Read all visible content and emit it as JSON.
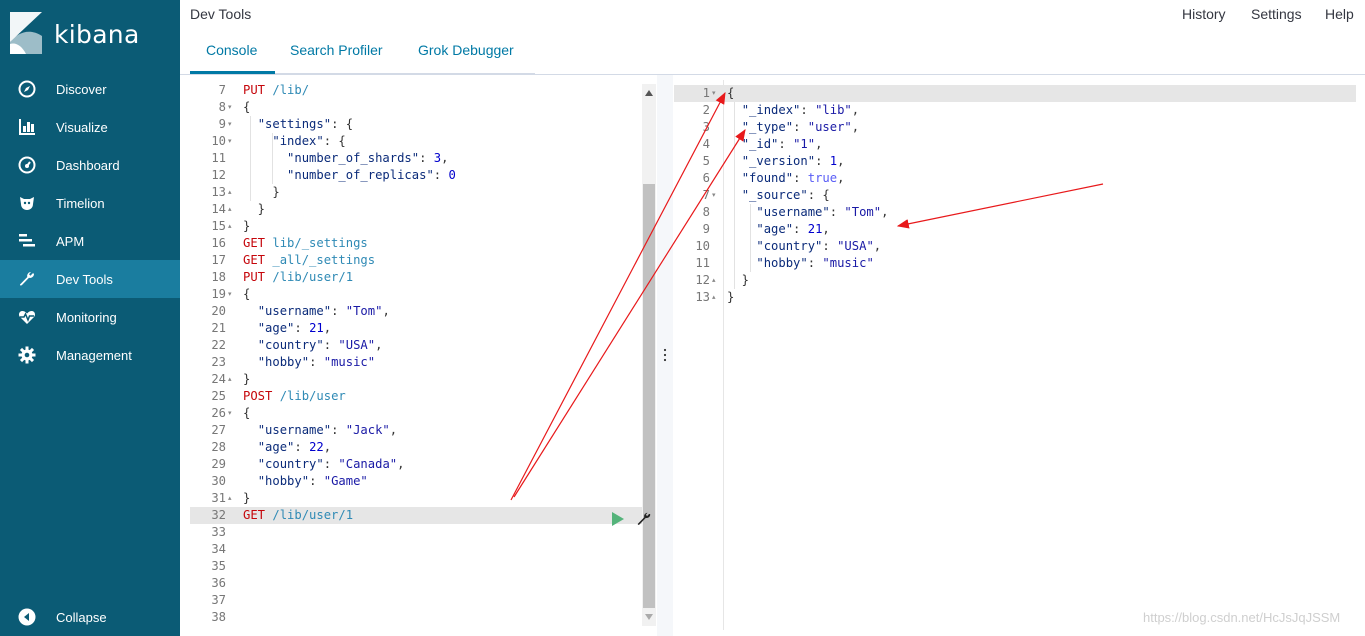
{
  "app": {
    "brand": "kibana",
    "page_title": "Dev Tools"
  },
  "topnav": {
    "history": "History",
    "settings": "Settings",
    "help": "Help"
  },
  "tabs": [
    {
      "label": "Console",
      "active": true
    },
    {
      "label": "Search Profiler",
      "active": false
    },
    {
      "label": "Grok Debugger",
      "active": false
    }
  ],
  "sidebar": {
    "items": [
      {
        "label": "Discover",
        "icon": "compass-icon"
      },
      {
        "label": "Visualize",
        "icon": "bar-chart-icon"
      },
      {
        "label": "Dashboard",
        "icon": "dashboard-icon"
      },
      {
        "label": "Timelion",
        "icon": "timelion-icon"
      },
      {
        "label": "APM",
        "icon": "apm-icon"
      },
      {
        "label": "Dev Tools",
        "icon": "wrench-icon",
        "active": true
      },
      {
        "label": "Monitoring",
        "icon": "heartbeat-icon"
      },
      {
        "label": "Management",
        "icon": "gear-icon"
      }
    ],
    "collapse": "Collapse"
  },
  "editor": {
    "lines": [
      {
        "n": "7",
        "fold": "",
        "tokens": [
          [
            "m",
            "PUT"
          ],
          [
            "p",
            " "
          ],
          [
            "u",
            "/lib/"
          ]
        ]
      },
      {
        "n": "8",
        "fold": "▾",
        "tokens": [
          [
            "p",
            "{"
          ]
        ]
      },
      {
        "n": "9",
        "fold": "▾",
        "tokens": [
          [
            "p",
            "  "
          ],
          [
            "k",
            "\"settings\""
          ],
          [
            "p",
            ": {"
          ]
        ]
      },
      {
        "n": "10",
        "fold": "▾",
        "tokens": [
          [
            "p",
            "    "
          ],
          [
            "k",
            "\"index\""
          ],
          [
            "p",
            ": {"
          ]
        ]
      },
      {
        "n": "11",
        "fold": "",
        "tokens": [
          [
            "p",
            "      "
          ],
          [
            "k",
            "\"number_of_shards\""
          ],
          [
            "p",
            ": "
          ],
          [
            "n",
            "3"
          ],
          [
            "p",
            ","
          ]
        ]
      },
      {
        "n": "12",
        "fold": "",
        "tokens": [
          [
            "p",
            "      "
          ],
          [
            "k",
            "\"number_of_replicas\""
          ],
          [
            "p",
            ": "
          ],
          [
            "n",
            "0"
          ]
        ]
      },
      {
        "n": "13",
        "fold": "▴",
        "tokens": [
          [
            "p",
            "    }"
          ]
        ]
      },
      {
        "n": "14",
        "fold": "▴",
        "tokens": [
          [
            "p",
            "  }"
          ]
        ]
      },
      {
        "n": "15",
        "fold": "▴",
        "tokens": [
          [
            "p",
            "}"
          ]
        ]
      },
      {
        "n": "16",
        "fold": "",
        "tokens": [
          [
            "m",
            "GET"
          ],
          [
            "p",
            " "
          ],
          [
            "u",
            "lib/_settings"
          ]
        ]
      },
      {
        "n": "17",
        "fold": "",
        "tokens": [
          [
            "m",
            "GET"
          ],
          [
            "p",
            " "
          ],
          [
            "u",
            "_all/_settings"
          ]
        ]
      },
      {
        "n": "18",
        "fold": "",
        "tokens": [
          [
            "m",
            "PUT"
          ],
          [
            "p",
            " "
          ],
          [
            "u",
            "/lib/user/1"
          ]
        ]
      },
      {
        "n": "19",
        "fold": "▾",
        "tokens": [
          [
            "p",
            "{"
          ]
        ]
      },
      {
        "n": "20",
        "fold": "",
        "tokens": [
          [
            "p",
            "  "
          ],
          [
            "k",
            "\"username\""
          ],
          [
            "p",
            ": "
          ],
          [
            "s",
            "\"Tom\""
          ],
          [
            "p",
            ","
          ]
        ]
      },
      {
        "n": "21",
        "fold": "",
        "tokens": [
          [
            "p",
            "  "
          ],
          [
            "k",
            "\"age\""
          ],
          [
            "p",
            ": "
          ],
          [
            "n",
            "21"
          ],
          [
            "p",
            ","
          ]
        ]
      },
      {
        "n": "22",
        "fold": "",
        "tokens": [
          [
            "p",
            "  "
          ],
          [
            "k",
            "\"country\""
          ],
          [
            "p",
            ": "
          ],
          [
            "s",
            "\"USA\""
          ],
          [
            "p",
            ","
          ]
        ]
      },
      {
        "n": "23",
        "fold": "",
        "tokens": [
          [
            "p",
            "  "
          ],
          [
            "k",
            "\"hobby\""
          ],
          [
            "p",
            ": "
          ],
          [
            "s",
            "\"music\""
          ]
        ]
      },
      {
        "n": "24",
        "fold": "▴",
        "tokens": [
          [
            "p",
            "}"
          ]
        ]
      },
      {
        "n": "25",
        "fold": "",
        "tokens": [
          [
            "m",
            "POST"
          ],
          [
            "p",
            " "
          ],
          [
            "u",
            "/lib/user"
          ]
        ]
      },
      {
        "n": "26",
        "fold": "▾",
        "tokens": [
          [
            "p",
            "{"
          ]
        ]
      },
      {
        "n": "27",
        "fold": "",
        "tokens": [
          [
            "p",
            "  "
          ],
          [
            "k",
            "\"username\""
          ],
          [
            "p",
            ": "
          ],
          [
            "s",
            "\"Jack\""
          ],
          [
            "p",
            ","
          ]
        ]
      },
      {
        "n": "28",
        "fold": "",
        "tokens": [
          [
            "p",
            "  "
          ],
          [
            "k",
            "\"age\""
          ],
          [
            "p",
            ": "
          ],
          [
            "n",
            "22"
          ],
          [
            "p",
            ","
          ]
        ]
      },
      {
        "n": "29",
        "fold": "",
        "tokens": [
          [
            "p",
            "  "
          ],
          [
            "k",
            "\"country\""
          ],
          [
            "p",
            ": "
          ],
          [
            "s",
            "\"Canada\""
          ],
          [
            "p",
            ","
          ]
        ]
      },
      {
        "n": "30",
        "fold": "",
        "tokens": [
          [
            "p",
            "  "
          ],
          [
            "k",
            "\"hobby\""
          ],
          [
            "p",
            ": "
          ],
          [
            "s",
            "\"Game\""
          ]
        ]
      },
      {
        "n": "31",
        "fold": "▴",
        "tokens": [
          [
            "p",
            "}"
          ]
        ]
      },
      {
        "n": "32",
        "fold": "",
        "tokens": [
          [
            "m",
            "GET"
          ],
          [
            "p",
            " "
          ],
          [
            "u",
            "/lib/user/1"
          ]
        ],
        "active": true
      },
      {
        "n": "33",
        "fold": "",
        "tokens": []
      },
      {
        "n": "34",
        "fold": "",
        "tokens": []
      },
      {
        "n": "35",
        "fold": "",
        "tokens": []
      },
      {
        "n": "36",
        "fold": "",
        "tokens": []
      },
      {
        "n": "37",
        "fold": "",
        "tokens": []
      },
      {
        "n": "38",
        "fold": "",
        "tokens": []
      }
    ]
  },
  "output": {
    "lines": [
      {
        "n": "1",
        "fold": "▾",
        "tokens": [
          [
            "p",
            "{"
          ]
        ],
        "active": true
      },
      {
        "n": "2",
        "fold": "",
        "tokens": [
          [
            "p",
            "  "
          ],
          [
            "k",
            "\"_index\""
          ],
          [
            "p",
            ": "
          ],
          [
            "s",
            "\"lib\""
          ],
          [
            "p",
            ","
          ]
        ]
      },
      {
        "n": "3",
        "fold": "",
        "tokens": [
          [
            "p",
            "  "
          ],
          [
            "k",
            "\"_type\""
          ],
          [
            "p",
            ": "
          ],
          [
            "s",
            "\"user\""
          ],
          [
            "p",
            ","
          ]
        ]
      },
      {
        "n": "4",
        "fold": "",
        "tokens": [
          [
            "p",
            "  "
          ],
          [
            "k",
            "\"_id\""
          ],
          [
            "p",
            ": "
          ],
          [
            "s",
            "\"1\""
          ],
          [
            "p",
            ","
          ]
        ]
      },
      {
        "n": "5",
        "fold": "",
        "tokens": [
          [
            "p",
            "  "
          ],
          [
            "k",
            "\"_version\""
          ],
          [
            "p",
            ": "
          ],
          [
            "n",
            "1"
          ],
          [
            "p",
            ","
          ]
        ]
      },
      {
        "n": "6",
        "fold": "",
        "tokens": [
          [
            "p",
            "  "
          ],
          [
            "k",
            "\"found\""
          ],
          [
            "p",
            ": "
          ],
          [
            "b",
            "true"
          ],
          [
            "p",
            ","
          ]
        ]
      },
      {
        "n": "7",
        "fold": "▾",
        "tokens": [
          [
            "p",
            "  "
          ],
          [
            "k",
            "\"_source\""
          ],
          [
            "p",
            ": {"
          ]
        ]
      },
      {
        "n": "8",
        "fold": "",
        "tokens": [
          [
            "p",
            "    "
          ],
          [
            "k",
            "\"username\""
          ],
          [
            "p",
            ": "
          ],
          [
            "s",
            "\"Tom\""
          ],
          [
            "p",
            ","
          ]
        ]
      },
      {
        "n": "9",
        "fold": "",
        "tokens": [
          [
            "p",
            "    "
          ],
          [
            "k",
            "\"age\""
          ],
          [
            "p",
            ": "
          ],
          [
            "n",
            "21"
          ],
          [
            "p",
            ","
          ]
        ]
      },
      {
        "n": "10",
        "fold": "",
        "tokens": [
          [
            "p",
            "    "
          ],
          [
            "k",
            "\"country\""
          ],
          [
            "p",
            ": "
          ],
          [
            "s",
            "\"USA\""
          ],
          [
            "p",
            ","
          ]
        ]
      },
      {
        "n": "11",
        "fold": "",
        "tokens": [
          [
            "p",
            "    "
          ],
          [
            "k",
            "\"hobby\""
          ],
          [
            "p",
            ": "
          ],
          [
            "s",
            "\"music\""
          ]
        ]
      },
      {
        "n": "12",
        "fold": "▴",
        "tokens": [
          [
            "p",
            "  }"
          ]
        ]
      },
      {
        "n": "13",
        "fold": "▴",
        "tokens": [
          [
            "p",
            "}"
          ]
        ]
      }
    ]
  },
  "watermark": "https://blog.csdn.net/HcJsJqJSSM",
  "colors": {
    "sidebar_bg": "#0b5b75",
    "sidebar_active": "#1a7d9f",
    "tab_accent": "#0079a5",
    "method": "#c5060b",
    "url": "#2f8ab5",
    "annotation_arrow": "#e8191b"
  }
}
